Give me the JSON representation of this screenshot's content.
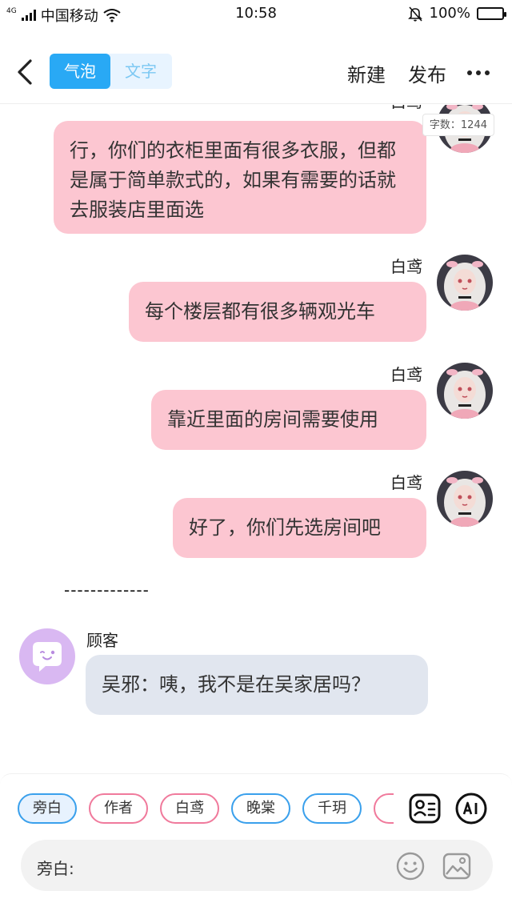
{
  "status_bar": {
    "network": "4G",
    "carrier": "中国移动",
    "time": "10:58",
    "battery": "100%",
    "battery_level": 1.0
  },
  "header": {
    "tabs": [
      {
        "label": "气泡",
        "active": true
      },
      {
        "label": "文字",
        "active": false
      }
    ],
    "new_label": "新建",
    "publish_label": "发布",
    "icons": [
      "back-icon",
      "more-icon"
    ]
  },
  "word_count": "字数：1244",
  "messages": [
    {
      "sender": "白鸢",
      "text": "行，你们的衣柜里面有很多衣服，但都是属于简单款式的，如果有需要的话就去服装店里面选",
      "side": "right"
    },
    {
      "sender": "白鸢",
      "text": "每个楼层都有很多辆观光车",
      "side": "right"
    },
    {
      "sender": "白鸢",
      "text": "靠近里面的房间需要使用",
      "side": "right"
    },
    {
      "sender": "白鸢",
      "text": "好了，你们先选房间吧",
      "side": "right"
    },
    {
      "sender": "顾客",
      "text": "吴邪：咦，我不是在吴家居吗？",
      "side": "left"
    }
  ],
  "divider": "-------------",
  "roles": [
    {
      "label": "旁白",
      "color": "#3aa0ec",
      "selected": true
    },
    {
      "label": "作者",
      "color": "#f07a9c",
      "selected": false
    },
    {
      "label": "白鸢",
      "color": "#f07a9c",
      "selected": false
    },
    {
      "label": "晚棠",
      "color": "#3aa0ec",
      "selected": false
    },
    {
      "label": "千玥",
      "color": "#3aa0ec",
      "selected": false
    },
    {
      "label": "",
      "color": "#f07a9c",
      "selected": false
    }
  ],
  "input": {
    "label": "旁白:",
    "value": ""
  },
  "colors": {
    "accent": "#29a9f5",
    "bubble_pink": "#fcc6d1",
    "bubble_gray": "#e1e6ef"
  }
}
